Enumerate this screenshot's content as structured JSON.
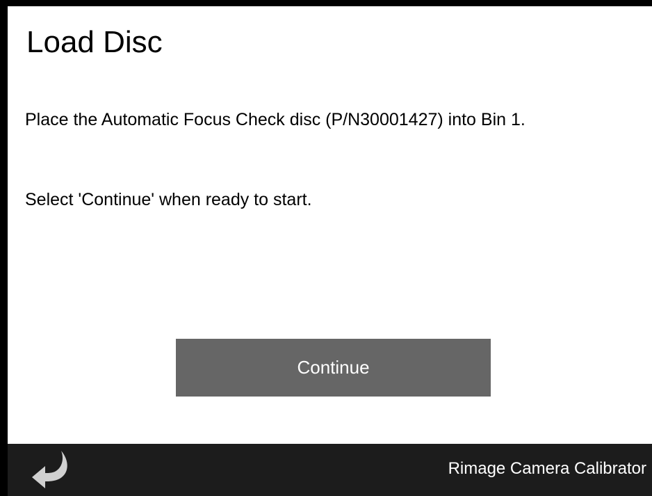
{
  "dialog": {
    "title": "Load Disc",
    "instruction": "Place the Automatic Focus Check disc (P/N30001427) into Bin 1.",
    "prompt": "Select 'Continue' when ready to start.",
    "continue_label": "Continue"
  },
  "footer": {
    "back_icon": "return-arrow-icon",
    "app_name": "Rimage Camera Calibrator"
  },
  "colors": {
    "background": "#ffffff",
    "button": "#666666",
    "footer": "#1c1c1c",
    "frame": "#000000",
    "icon": "#d0d0d0"
  }
}
